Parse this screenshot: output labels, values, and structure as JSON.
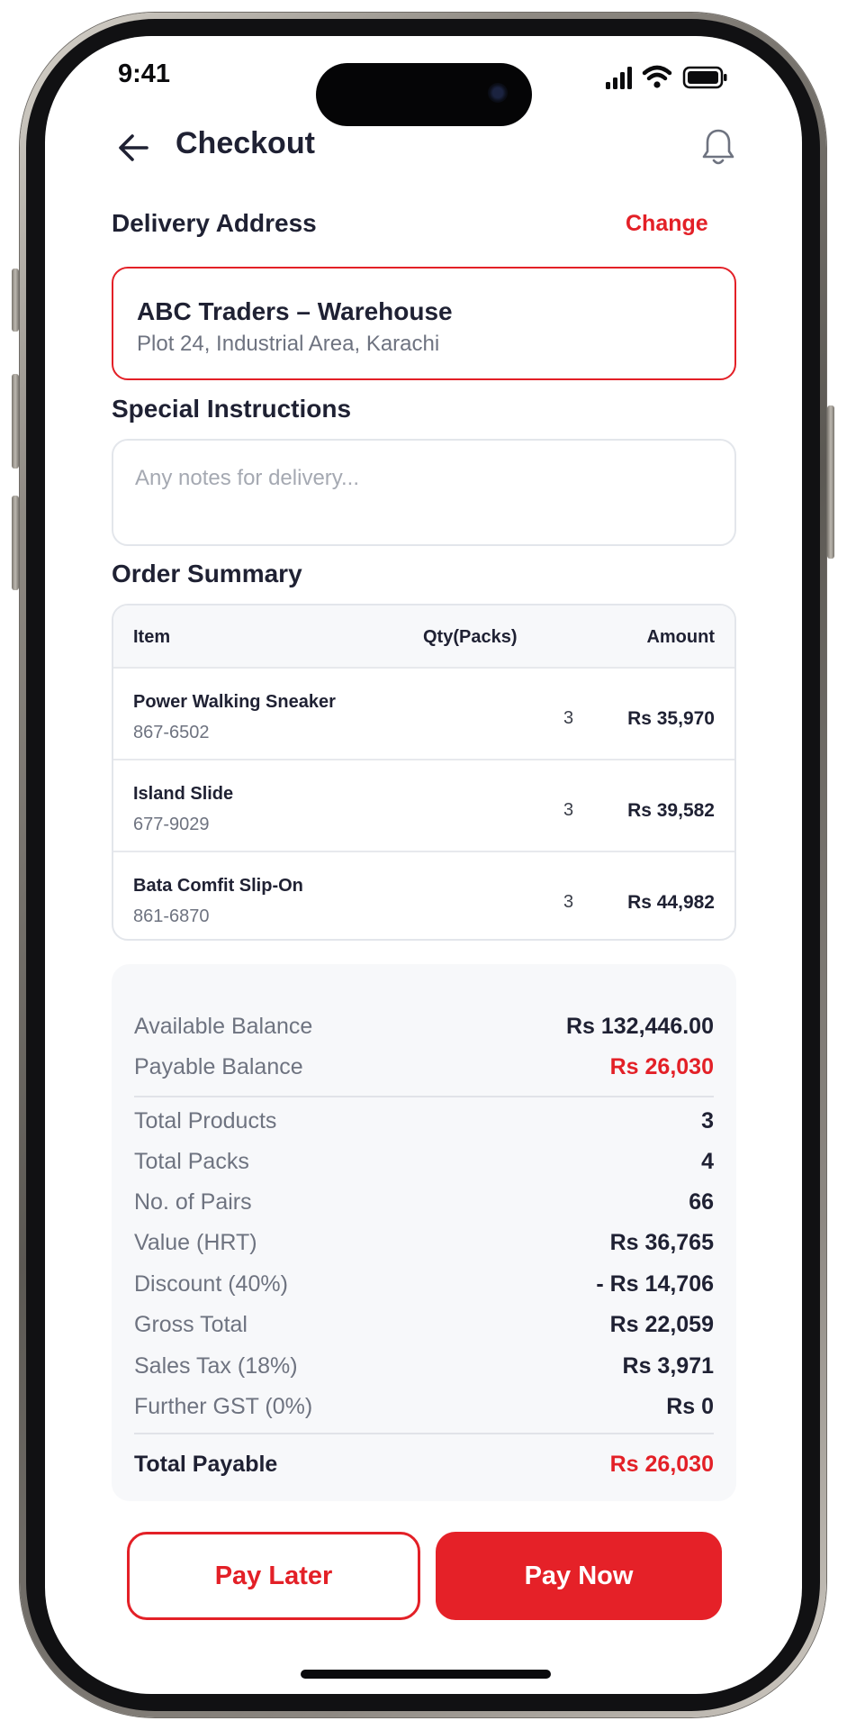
{
  "status_bar": {
    "time": "9:41"
  },
  "header": {
    "title": "Checkout"
  },
  "delivery": {
    "title": "Delivery Address",
    "change_label": "Change",
    "name": "ABC Traders – Warehouse",
    "address": "Plot 24, Industrial Area, Karachi"
  },
  "instructions": {
    "title": "Special Instructions",
    "placeholder": "Any notes for delivery...",
    "value": ""
  },
  "order_summary": {
    "title": "Order Summary",
    "columns": [
      "Item",
      "Qty(Packs)",
      "Amount"
    ],
    "items": [
      {
        "name": "Power Walking Sneaker",
        "code": "867-6502",
        "qty": "3",
        "amount": "Rs 35,970"
      },
      {
        "name": "Island Slide",
        "code": "677-9029",
        "qty": "3",
        "amount": "Rs 39,582"
      },
      {
        "name": "Bata Comfit Slip-On",
        "code": "861-6870",
        "qty": "3",
        "amount": "Rs 44,982"
      }
    ]
  },
  "balance": {
    "available_label": "Available Balance",
    "available_value": "Rs 132,446.00",
    "payable_label": "Payable Balance",
    "payable_value": "Rs 26,030"
  },
  "totals": [
    {
      "label": "Total Products",
      "value": "3"
    },
    {
      "label": "Total Packs",
      "value": "4"
    },
    {
      "label": "No. of Pairs",
      "value": "66"
    },
    {
      "label": "Value (HRT)",
      "value": "Rs 36,765"
    },
    {
      "label": "Discount (40%)",
      "value": "- Rs 14,706"
    },
    {
      "label": "Gross Total",
      "value": "Rs 22,059"
    },
    {
      "label": "Sales Tax (18%)",
      "value": "Rs 3,971"
    },
    {
      "label": "Further GST (0%)",
      "value": "Rs 0"
    }
  ],
  "total_payable": {
    "label": "Total Payable",
    "value": "Rs 26,030"
  },
  "actions": {
    "pay_later": "Pay Later",
    "pay_now": "Pay Now"
  },
  "colors": {
    "accent": "#e32027",
    "text": "#1f2133",
    "muted": "#6e7380",
    "panel": "#f7f8fa"
  },
  "icons": {
    "back": "arrow-left-icon",
    "notifications": "bell-icon",
    "signal": "cellular-signal-icon",
    "wifi": "wifi-icon",
    "battery": "battery-icon"
  }
}
